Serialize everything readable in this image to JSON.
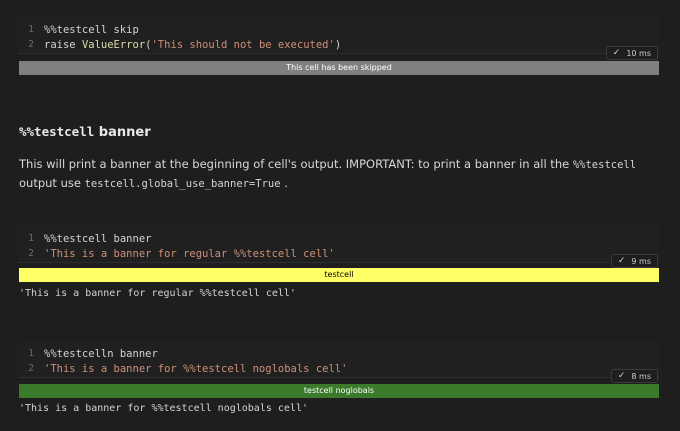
{
  "cells": [
    {
      "lines": [
        {
          "num": "1",
          "parts": [
            {
              "text": "%%testcell skip",
              "kind": "kw"
            }
          ]
        },
        {
          "num": "2",
          "parts": [
            {
              "text": "raise ",
              "kind": "kw"
            },
            {
              "text": "ValueError",
              "kind": "fn"
            },
            {
              "text": "(",
              "kind": "kw"
            },
            {
              "text": "'This should not be executed'",
              "kind": "str"
            },
            {
              "text": ")",
              "kind": "kw"
            }
          ]
        }
      ],
      "status": "10 ms",
      "banner": {
        "text": "This cell has been skipped",
        "bg": "#808080",
        "fg": "#ffffff"
      },
      "output": ""
    },
    {
      "lines": [
        {
          "num": "1",
          "parts": [
            {
              "text": "%%testcell banner",
              "kind": "kw"
            }
          ]
        },
        {
          "num": "2",
          "parts": [
            {
              "text": "'This is a banner for regular %%testcell cell'",
              "kind": "str"
            }
          ]
        }
      ],
      "status": "9 ms",
      "banner": {
        "text": "testcell",
        "bg": "#ffff66",
        "fg": "#000000"
      },
      "output": "'This is a banner for regular %%testcell cell'"
    },
    {
      "lines": [
        {
          "num": "1",
          "parts": [
            {
              "text": "%%testcelln banner",
              "kind": "kw"
            }
          ]
        },
        {
          "num": "2",
          "parts": [
            {
              "text": "'This is a banner for %%testcell noglobals cell'",
              "kind": "str"
            }
          ]
        }
      ],
      "status": "8 ms",
      "banner": {
        "text": "testcell noglobals",
        "bg": "#3a7a2a",
        "fg": "#ffffff"
      },
      "output": "'This is a banner for %%testcell noglobals cell'"
    }
  ],
  "markdown": {
    "heading_code": "%%testcell",
    "heading_text": " banner",
    "para_text1": "This will print a banner at the beginning of cell's output. IMPORTANT: to print a banner in all the ",
    "para_code1": "%%testcell",
    "para_text2": " output use ",
    "para_code2": "testcell.global_use_banner=True",
    "para_text3": " ."
  },
  "icons": {
    "status_check": "checkmark-icon"
  }
}
